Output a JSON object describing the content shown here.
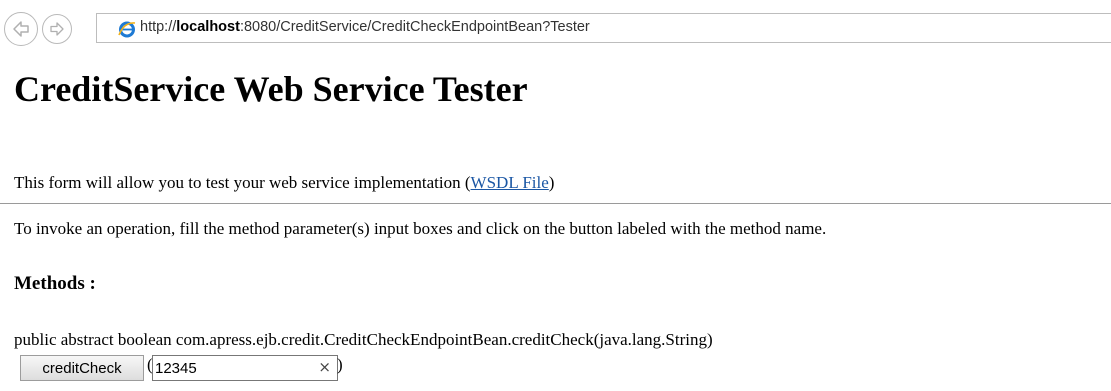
{
  "browser": {
    "url_prefix": "http://",
    "url_host": "localhost",
    "url_rest": ":8080/CreditService/CreditCheckEndpointBean?Tester",
    "back_icon": "back-arrow-icon",
    "forward_icon": "forward-arrow-icon",
    "page_icon": "internet-explorer-icon"
  },
  "page": {
    "title": "CreditService Web Service Tester",
    "intro_text": "This form will allow you to test your web service implementation (",
    "wsdl_link": "WSDL File",
    "intro_close": ")",
    "instructions": "To invoke an operation, fill the method parameter(s) input boxes and click on the button labeled with the method name.",
    "methods_heading": "Methods :"
  },
  "method": {
    "signature": "public abstract boolean com.apress.ejb.credit.CreditCheckEndpointBean.creditCheck(java.lang.String)",
    "button_label": "creditCheck",
    "paren_open": "(",
    "paren_close": ")",
    "param_value": "12345",
    "clear_symbol": "×"
  },
  "colors": {
    "link": "#1a56a4",
    "divider": "#9a9a9a"
  }
}
